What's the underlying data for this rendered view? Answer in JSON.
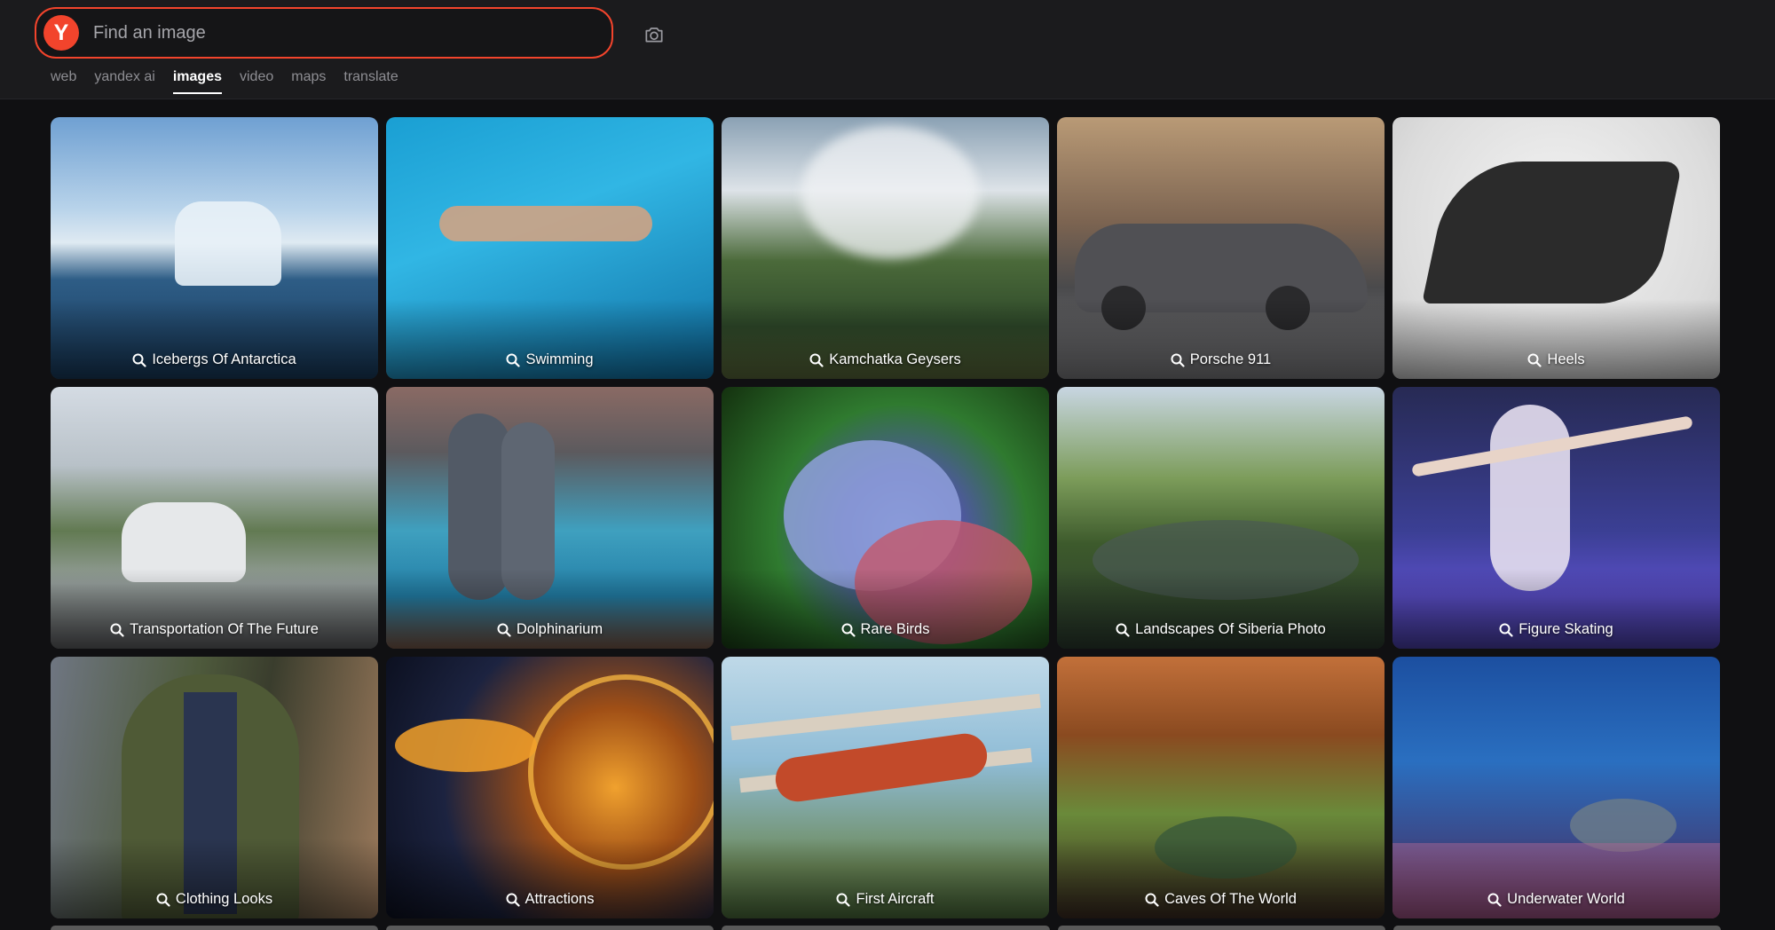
{
  "search": {
    "logo_letter": "Y",
    "placeholder": "Find an image",
    "value": "",
    "camera_icon": "camera-icon"
  },
  "nav": {
    "tabs": [
      {
        "label": "web",
        "active": false
      },
      {
        "label": "yandex ai",
        "active": false
      },
      {
        "label": "images",
        "active": true
      },
      {
        "label": "video",
        "active": false
      },
      {
        "label": "maps",
        "active": false
      },
      {
        "label": "translate",
        "active": false
      }
    ]
  },
  "tiles": [
    {
      "label": "Icebergs Of Antarctica"
    },
    {
      "label": "Swimming"
    },
    {
      "label": "Kamchatka Geysers"
    },
    {
      "label": "Porsche 911"
    },
    {
      "label": "Heels"
    },
    {
      "label": "Transportation Of The Future"
    },
    {
      "label": "Dolphinarium"
    },
    {
      "label": "Rare Birds"
    },
    {
      "label": "Landscapes Of Siberia Photo"
    },
    {
      "label": "Figure Skating"
    },
    {
      "label": "Clothing Looks"
    },
    {
      "label": "Attractions"
    },
    {
      "label": "First Aircraft"
    },
    {
      "label": "Caves Of The World"
    },
    {
      "label": "Underwater World"
    }
  ],
  "colors": {
    "accent": "#f2442c",
    "background": "#101012",
    "header": "#1b1b1d"
  }
}
